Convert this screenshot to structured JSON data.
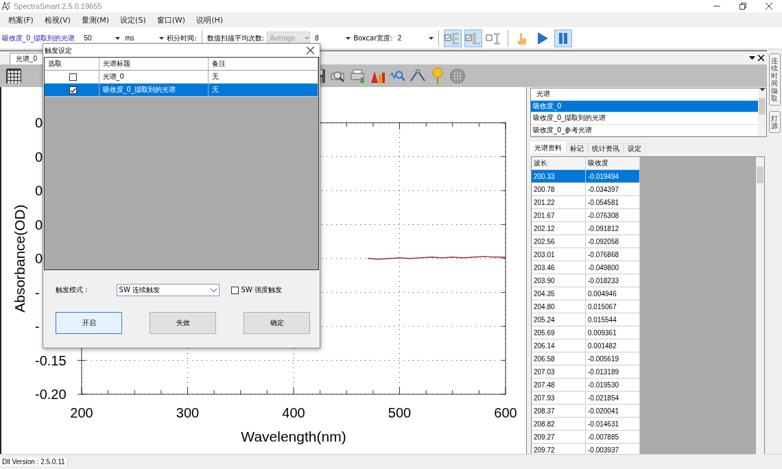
{
  "window": {
    "title": "SpectraSmart 2.5.0.19655"
  },
  "menu": [
    "档案(F)",
    "检视(V)",
    "量测(M)",
    "设定(S)",
    "窗口(W)",
    "说明(H)"
  ],
  "toolbar": {
    "spectrum_link": "吸收度_0_擷取到的光谱",
    "integration_value": "50",
    "integration_unit": "ms",
    "integration_label": "积分时间:",
    "average_label": "数值扫描平均次数:",
    "average_mode": {
      "value": "Average",
      "disabled": true
    },
    "average_count": "8",
    "boxcar_label": "Boxcar宽度:",
    "boxcar_value": "2",
    "buttons": [
      {
        "kind": "check-e",
        "on": true,
        "checked": true
      },
      {
        "kind": "check-l",
        "on": true,
        "checked": true
      },
      {
        "kind": "check-i",
        "on": false,
        "checked": false
      },
      {
        "kind": "hand",
        "on": false
      },
      {
        "kind": "play",
        "on": false
      },
      {
        "kind": "pause",
        "on": true
      }
    ]
  },
  "doc_tab": {
    "label": "光谱_0"
  },
  "chart": {
    "chart_data": {
      "type": "line",
      "xlabel": "Wavelength(nm)",
      "ylabel": "Absorbance(OD)",
      "xlim": [
        200,
        600
      ],
      "ylim": [
        -0.2,
        0.2
      ],
      "xticks": [
        200,
        300,
        400,
        500,
        600
      ],
      "yticks": [
        {
          "value": 0.2,
          "label": "0"
        },
        {
          "value": 0.15,
          "label": "0"
        },
        {
          "value": 0.1,
          "label": "0"
        },
        {
          "value": 0.05,
          "label": "0"
        },
        {
          "value": 0,
          "label": "0"
        },
        {
          "value": -0.05,
          "label": "-"
        },
        {
          "value": -0.1,
          "label": "-"
        },
        {
          "value": -0.15,
          "label": "-0.15"
        },
        {
          "value": -0.2,
          "label": "-0.20"
        }
      ],
      "x": [
        470,
        480,
        490,
        500,
        510,
        520,
        530,
        540,
        550,
        560,
        570,
        580,
        590,
        600
      ],
      "grid": true,
      "series": [
        {
          "color": "#a0302a",
          "values": [
            0.0,
            -0.001,
            0.0,
            0.001,
            0.0,
            0.001,
            0.002,
            0.001,
            0.002,
            0.001,
            0.002,
            0.003,
            0.002,
            0.002
          ]
        }
      ]
    }
  },
  "spectrum_list": {
    "header": "光谱",
    "items": [
      {
        "label": "吸收度_0",
        "selected": true
      },
      {
        "label": "吸收度_0_擷取到的光谱",
        "selected": false
      },
      {
        "label": "吸收度_0_参考光谱",
        "selected": false
      }
    ]
  },
  "data_tabs": [
    {
      "label": "光谱资料",
      "selected": true
    },
    {
      "label": "标记",
      "selected": false
    },
    {
      "label": "统计资讯",
      "selected": false
    },
    {
      "label": "设定",
      "selected": false
    }
  ],
  "data_table": {
    "columns": [
      "波长",
      "吸收度"
    ],
    "rows": [
      {
        "cells": [
          "200.33",
          "-0.019494"
        ],
        "selected": true
      },
      {
        "cells": [
          "200.78",
          "-0.034397"
        ],
        "selected": false
      },
      {
        "cells": [
          "201.22",
          "-0.054581"
        ],
        "selected": false
      },
      {
        "cells": [
          "201.67",
          "-0.076308"
        ],
        "selected": false
      },
      {
        "cells": [
          "202.12",
          "-0.091812"
        ],
        "selected": false
      },
      {
        "cells": [
          "202.56",
          "-0.092058"
        ],
        "selected": false
      },
      {
        "cells": [
          "203.01",
          "-0.076868"
        ],
        "selected": false
      },
      {
        "cells": [
          "203.46",
          "-0.049800"
        ],
        "selected": false
      },
      {
        "cells": [
          "203.90",
          "-0.018233"
        ],
        "selected": false
      },
      {
        "cells": [
          "204.35",
          "0.004946"
        ],
        "selected": false
      },
      {
        "cells": [
          "204.80",
          "0.015067"
        ],
        "selected": false
      },
      {
        "cells": [
          "205.24",
          "0.015544"
        ],
        "selected": false
      },
      {
        "cells": [
          "205.69",
          "0.009361"
        ],
        "selected": false
      },
      {
        "cells": [
          "206.14",
          "0.001482"
        ],
        "selected": false
      },
      {
        "cells": [
          "206.58",
          "-0.005619"
        ],
        "selected": false
      },
      {
        "cells": [
          "207.03",
          "-0.013189"
        ],
        "selected": false
      },
      {
        "cells": [
          "207.48",
          "-0.019530"
        ],
        "selected": false
      },
      {
        "cells": [
          "207.93",
          "-0.021854"
        ],
        "selected": false
      },
      {
        "cells": [
          "208.37",
          "-0.020041"
        ],
        "selected": false
      },
      {
        "cells": [
          "208.82",
          "-0.014631"
        ],
        "selected": false
      },
      {
        "cells": [
          "209.27",
          "-0.007885"
        ],
        "selected": false
      },
      {
        "cells": [
          "209.72",
          "-0.003937"
        ],
        "selected": false
      }
    ]
  },
  "side_tabs": [
    "连续时间撷取",
    "灯源"
  ],
  "dialog": {
    "title": "触发设定",
    "columns": [
      "选取",
      "光谱标题",
      "备注"
    ],
    "rows": [
      {
        "checked": false,
        "title": "光谱_0",
        "note": "无",
        "selected": false
      },
      {
        "checked": true,
        "title": "吸收度_0_擷取到的光谱",
        "note": "无",
        "selected": true
      }
    ],
    "mode_label": "触发模式 :",
    "mode_value": "SW 连续触发",
    "intensity": {
      "label": "SW 强度触发",
      "checked": false
    },
    "buttons": [
      {
        "label": "开启",
        "focused": true
      },
      {
        "label": "失效",
        "focused": false
      },
      {
        "label": "确定",
        "focused": false
      }
    ]
  },
  "status_bar": "Dll Version : 2.5.0.11"
}
